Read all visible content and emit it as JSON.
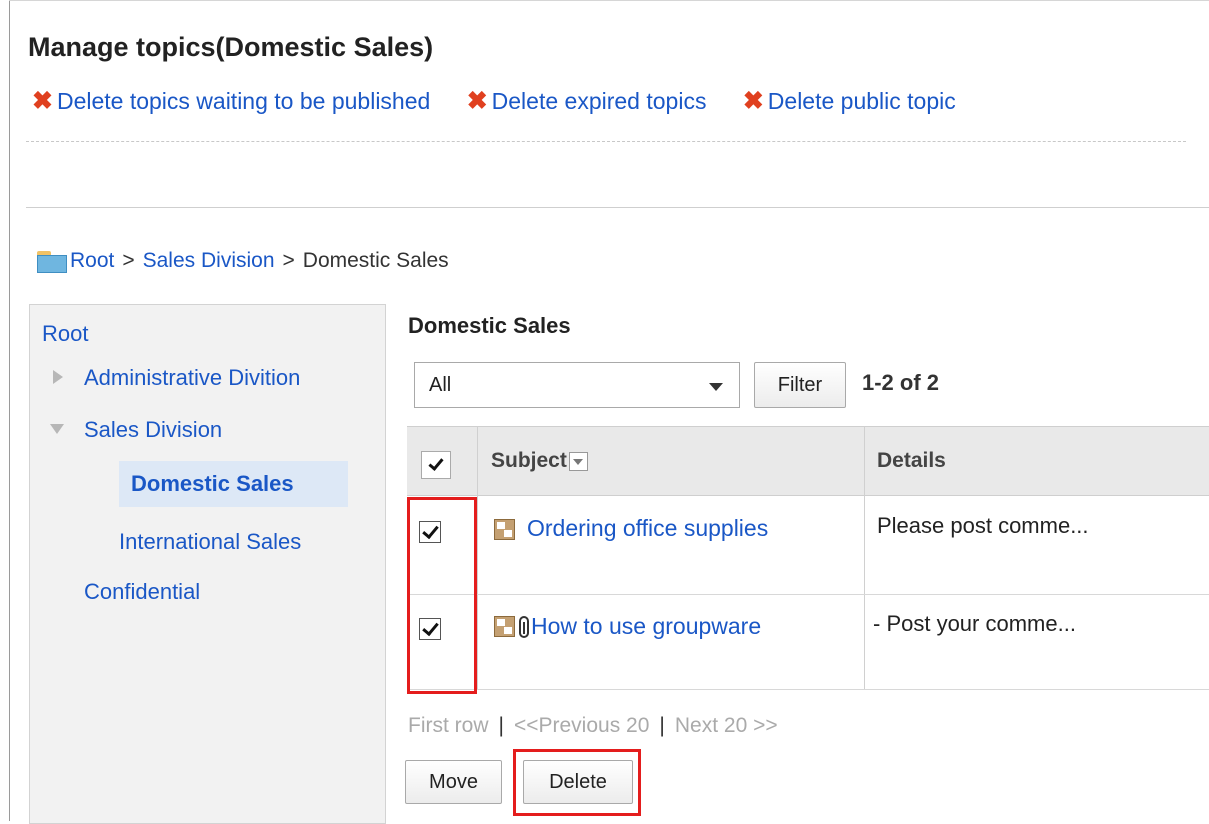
{
  "page": {
    "title": "Manage topics(Domestic Sales)"
  },
  "actions": [
    {
      "label": "Delete topics waiting to be published",
      "icon": "delete-x-icon"
    },
    {
      "label": "Delete expired topics",
      "icon": "delete-x-icon"
    },
    {
      "label": "Delete public topic",
      "icon": "delete-x-icon"
    }
  ],
  "breadcrumb": {
    "items": [
      "Root",
      "Sales Division"
    ],
    "separator": ">",
    "current": "Domestic Sales"
  },
  "tree": {
    "items": [
      {
        "label": "Root"
      },
      {
        "label": "Administrative Divition"
      },
      {
        "label": "Sales Division"
      },
      {
        "label": "Domestic Sales"
      },
      {
        "label": "International Sales"
      },
      {
        "label": "Confidential"
      }
    ]
  },
  "main": {
    "heading": "Domestic Sales",
    "filter_select": "All",
    "filter_button": "Filter",
    "count": "1-2 of 2"
  },
  "table": {
    "columns": [
      "Subject",
      "Details"
    ],
    "rows": [
      {
        "checked": true,
        "subject": "Ordering office supplies",
        "details": "Please post comme...",
        "attachment": false
      },
      {
        "checked": true,
        "subject": "How to use groupware",
        "details": "- Post your comme...",
        "attachment": true
      }
    ]
  },
  "pager": {
    "first": "First row",
    "separator": "|",
    "previous": "<<Previous 20",
    "next": "Next 20 >>"
  },
  "buttons": {
    "move": "Move",
    "delete": "Delete"
  },
  "colors": {
    "link": "#1a57c6",
    "delete_icon": "#e0401f",
    "highlight": "#e41d1d",
    "selected_bg": "#dde8f6"
  }
}
